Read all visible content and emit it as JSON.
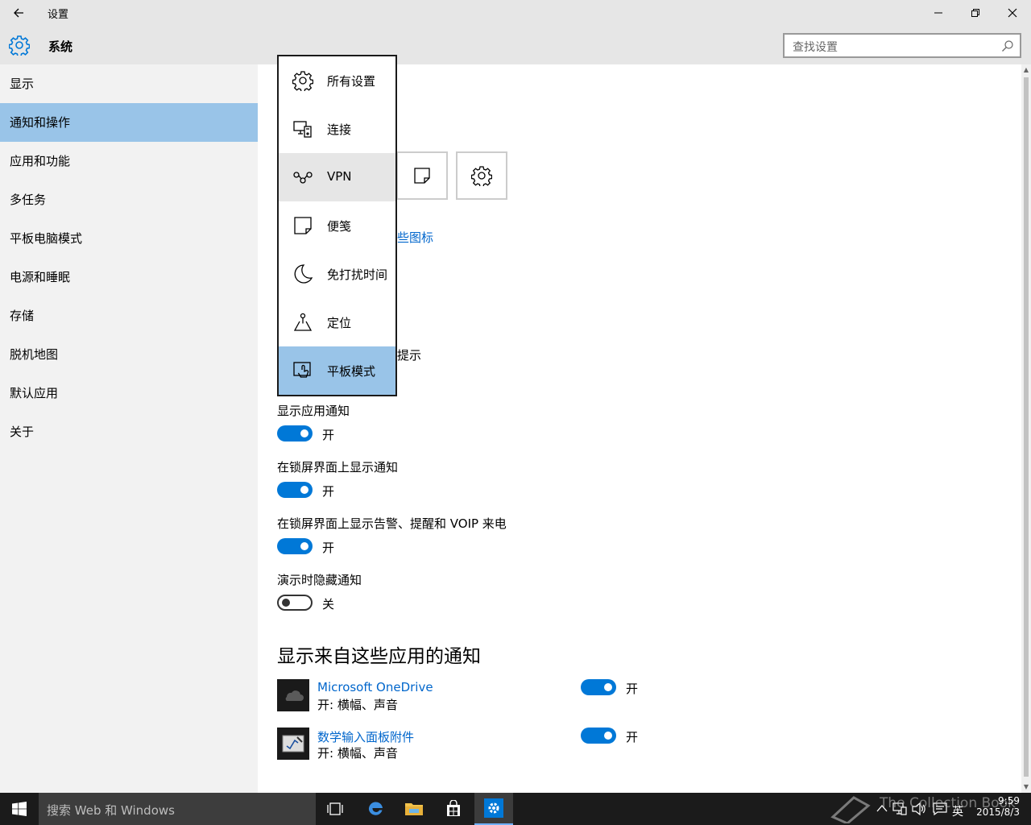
{
  "window": {
    "title": "设置"
  },
  "header": {
    "title": "系统",
    "search_placeholder": "查找设置"
  },
  "sidebar": {
    "items": [
      {
        "label": "显示"
      },
      {
        "label": "通知和操作",
        "active": true
      },
      {
        "label": "应用和功能"
      },
      {
        "label": "多任务"
      },
      {
        "label": "平板电脑模式"
      },
      {
        "label": "电源和睡眠"
      },
      {
        "label": "存储"
      },
      {
        "label": "脱机地图"
      },
      {
        "label": "默认应用"
      },
      {
        "label": "关于"
      }
    ]
  },
  "dropdown": {
    "items": [
      {
        "label": "所有设置",
        "icon": "gear-icon"
      },
      {
        "label": "连接",
        "icon": "connect-icon"
      },
      {
        "label": "VPN",
        "icon": "vpn-icon",
        "state": "hover"
      },
      {
        "label": "便笺",
        "icon": "note-icon"
      },
      {
        "label": "免打扰时间",
        "icon": "moon-icon"
      },
      {
        "label": "定位",
        "icon": "location-icon"
      },
      {
        "label": "平板模式",
        "icon": "tablet-mode-icon",
        "state": "selected"
      }
    ]
  },
  "main": {
    "quick_action_tiles": [
      "note-icon",
      "gear-icon"
    ],
    "partial_link": "些图标",
    "partial_text": "提示",
    "settings": [
      {
        "label": "显示应用通知",
        "state": "开",
        "on": true
      },
      {
        "label": "在锁屏界面上显示通知",
        "state": "开",
        "on": true
      },
      {
        "label": "在锁屏界面上显示告警、提醒和 VOIP 来电",
        "state": "开",
        "on": true
      },
      {
        "label": "演示时隐藏通知",
        "state": "关",
        "on": false
      }
    ],
    "apps_section_title": "显示来自这些应用的通知",
    "apps": [
      {
        "name": "Microsoft OneDrive",
        "sub": "开: 横幅、声音",
        "state": "开",
        "icon": "onedrive-icon"
      },
      {
        "name": "数学输入面板附件",
        "sub": "开: 横幅、声音",
        "state": "开",
        "icon": "math-input-icon"
      }
    ]
  },
  "taskbar": {
    "search_placeholder": "搜索 Web 和 Windows",
    "tray_lang": "英",
    "time": "9:59",
    "date": "2015/8/3",
    "watermark": "The Collection Book"
  },
  "colors": {
    "accent": "#0078d7",
    "active_nav": "#99c4e8",
    "link": "#0066cc"
  }
}
